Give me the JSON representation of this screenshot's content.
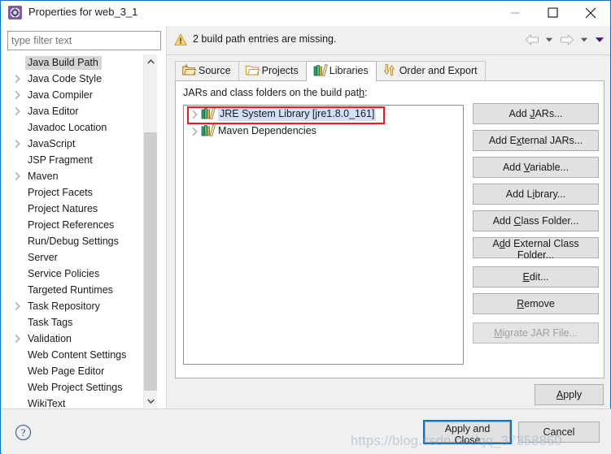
{
  "window": {
    "title": "Properties for web_3_1",
    "icon": "eclipse-properties-icon",
    "minimize_label": "Minimize",
    "maximize_label": "Maximize",
    "close_label": "Close"
  },
  "filter": {
    "placeholder": "type filter text",
    "value": ""
  },
  "sidebar": {
    "items": [
      {
        "label": "Java Build Path",
        "expandable": false,
        "selected": true
      },
      {
        "label": "Java Code Style",
        "expandable": true,
        "selected": false
      },
      {
        "label": "Java Compiler",
        "expandable": true,
        "selected": false
      },
      {
        "label": "Java Editor",
        "expandable": true,
        "selected": false
      },
      {
        "label": "Javadoc Location",
        "expandable": false,
        "selected": false
      },
      {
        "label": "JavaScript",
        "expandable": true,
        "selected": false
      },
      {
        "label": "JSP Fragment",
        "expandable": false,
        "selected": false
      },
      {
        "label": "Maven",
        "expandable": true,
        "selected": false
      },
      {
        "label": "Project Facets",
        "expandable": false,
        "selected": false
      },
      {
        "label": "Project Natures",
        "expandable": false,
        "selected": false
      },
      {
        "label": "Project References",
        "expandable": false,
        "selected": false
      },
      {
        "label": "Run/Debug Settings",
        "expandable": false,
        "selected": false
      },
      {
        "label": "Server",
        "expandable": false,
        "selected": false
      },
      {
        "label": "Service Policies",
        "expandable": false,
        "selected": false
      },
      {
        "label": "Targeted Runtimes",
        "expandable": false,
        "selected": false
      },
      {
        "label": "Task Repository",
        "expandable": true,
        "selected": false
      },
      {
        "label": "Task Tags",
        "expandable": false,
        "selected": false
      },
      {
        "label": "Validation",
        "expandable": true,
        "selected": false
      },
      {
        "label": "Web Content Settings",
        "expandable": false,
        "selected": false
      },
      {
        "label": "Web Page Editor",
        "expandable": false,
        "selected": false
      },
      {
        "label": "Web Project Settings",
        "expandable": false,
        "selected": false
      },
      {
        "label": "WikiText",
        "expandable": false,
        "selected": false
      }
    ]
  },
  "banner": {
    "icon": "warning-icon",
    "message": "2 build path entries are missing.",
    "nav": {
      "back_label": "Back",
      "forward_label": "Forward",
      "menu_label": "View Menu"
    }
  },
  "tabs": [
    {
      "label": "Source",
      "icon": "source-folder-icon",
      "active": false
    },
    {
      "label": "Projects",
      "icon": "open-folder-icon",
      "active": false
    },
    {
      "label": "Libraries",
      "icon": "library-books-icon",
      "active": true
    },
    {
      "label": "Order and Export",
      "icon": "order-export-icon",
      "active": false
    }
  ],
  "libraries_tab": {
    "list_label": "JARs and class folders on the build path:",
    "entries": [
      {
        "label": "JRE System Library [jre1.8.0_161]",
        "icon": "library-books-icon",
        "selected": true,
        "annotated": true
      },
      {
        "label": "Maven Dependencies",
        "icon": "library-books-icon",
        "selected": false,
        "annotated": false
      }
    ],
    "buttons": [
      {
        "label": "Add JARs...",
        "mnemonic": "J",
        "enabled": true,
        "gap": false
      },
      {
        "label": "Add External JARs...",
        "mnemonic": "x",
        "enabled": true,
        "gap": false
      },
      {
        "label": "Add Variable...",
        "mnemonic": "V",
        "enabled": true,
        "gap": false
      },
      {
        "label": "Add Library...",
        "mnemonic": "i",
        "enabled": true,
        "gap": false
      },
      {
        "label": "Add Class Folder...",
        "mnemonic": "C",
        "enabled": true,
        "gap": false
      },
      {
        "label": "Add External Class Folder...",
        "mnemonic": "d",
        "enabled": true,
        "gap": false
      },
      {
        "label": "Edit...",
        "mnemonic": "E",
        "enabled": true,
        "gap": true
      },
      {
        "label": "Remove",
        "mnemonic": "R",
        "enabled": true,
        "gap": false
      },
      {
        "label": "Migrate JAR File...",
        "mnemonic": "M",
        "enabled": false,
        "gap": true
      }
    ]
  },
  "footer": {
    "apply_label": "Apply",
    "apply_mnemonic": "A",
    "help_icon": "help-question-icon",
    "apply_and_close_label": "Apply and Close",
    "cancel_label": "Cancel"
  },
  "watermark": {
    "text": "https://blog.csdn.net/qq_37358860"
  },
  "colors": {
    "accent": "#0a74c4",
    "annotation": "#ee1c22",
    "selection": "#cde2f5",
    "tree_selection": "#d6d6d6",
    "chrome": "#f0f0f0",
    "button_face": "#e1e1e1",
    "warning": "#f0c020"
  }
}
